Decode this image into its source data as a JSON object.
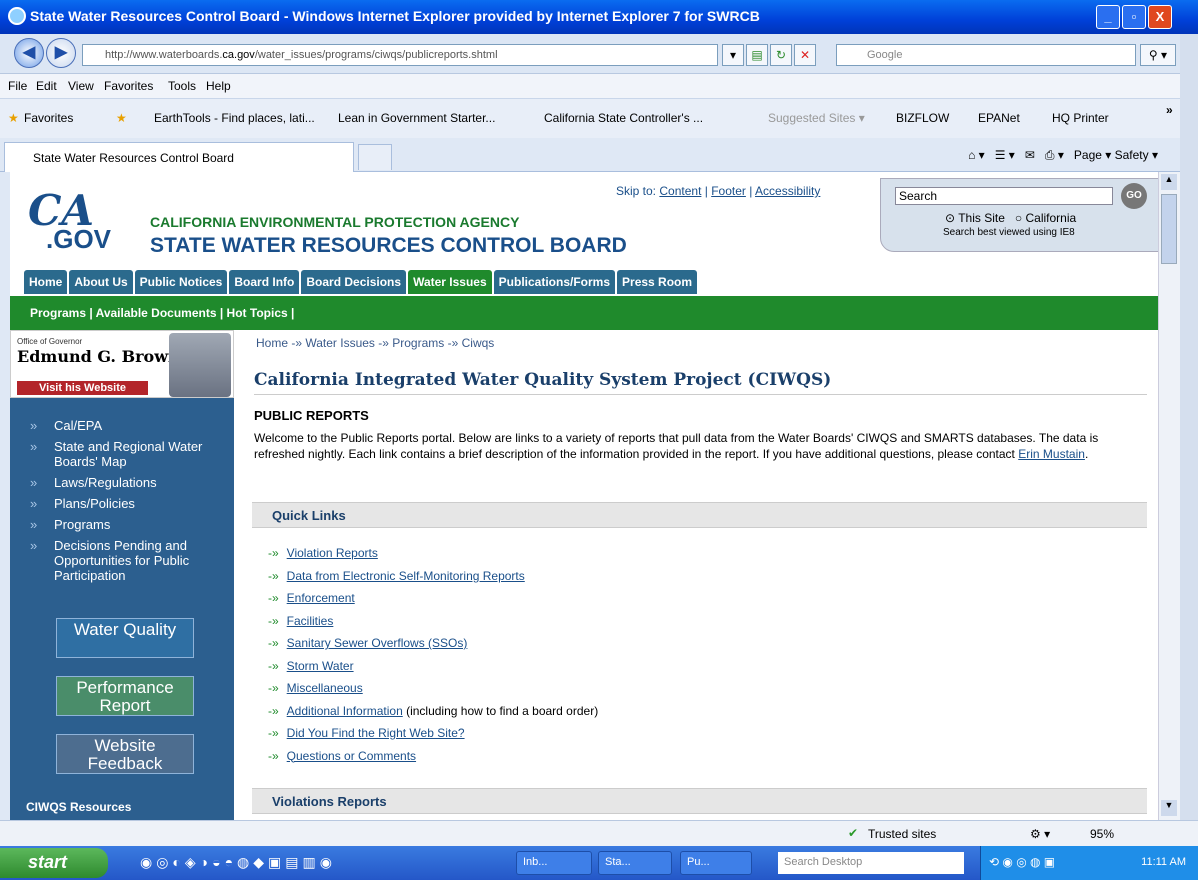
{
  "window": {
    "title": "State Water Resources Control Board - Windows Internet Explorer provided by Internet Explorer 7 for SWRCB",
    "minimize": "_",
    "maximize": "▫",
    "close": "X"
  },
  "address": {
    "url_prefix": "http://www.waterboards.",
    "url_domain": "ca.gov",
    "url_suffix": "/water_issues/programs/ciwqs/publicreports.shtml",
    "search_placeholder": "Google"
  },
  "menu": [
    "File",
    "Edit",
    "View",
    "Favorites",
    "Tools",
    "Help"
  ],
  "favorites": {
    "label": "Favorites",
    "items": [
      "EarthTools - Find places, lati...",
      "Lean in Government Starter...",
      "California State Controller's ...",
      "Suggested Sites ▾",
      "BIZFLOW",
      "EPANet",
      "HQ Printer"
    ]
  },
  "tab": {
    "title": "State Water Resources Control Board",
    "tools": "Page ▾  Safety ▾"
  },
  "site": {
    "logo_ca": "CA",
    "logo_gov": ".GOV",
    "agency": "CALIFORNIA ENVIRONMENTAL PROTECTION AGENCY",
    "board": "STATE WATER RESOURCES CONTROL BOARD",
    "skip_to": "Skip to:",
    "skip_content": "Content",
    "skip_footer": "Footer",
    "skip_access": "Accessibility",
    "search_value": "Search",
    "go": "GO",
    "radio_site": "This Site",
    "radio_ca": "California",
    "ie8_note": "Search best viewed using IE8"
  },
  "navtabs": [
    "Home",
    "About Us",
    "Public Notices",
    "Board Info",
    "Board Decisions",
    "Water Issues",
    "Publications/Forms",
    "Press Room"
  ],
  "subnav": "Programs | Available Documents | Hot Topics |",
  "sidebar": {
    "gov_office": "Office of Governor",
    "gov_name": "Edmund G. Brown Jr.",
    "gov_visit": "Visit his Website",
    "items": [
      "Cal/EPA",
      "State and Regional Water Boards' Map",
      "Laws/Regulations",
      "Plans/Policies",
      "Programs",
      "Decisions Pending and Opportunities for Public Participation"
    ],
    "wq": "Water Quality",
    "perf": "Performance Report",
    "feedback": "Website Feedback",
    "ciwqs": "CIWQS Resources"
  },
  "main": {
    "breadcrumb": "Home -» Water Issues -» Programs -» Ciwqs",
    "title": "California Integrated Water Quality System Project (CIWQS)",
    "subtitle": "PUBLIC REPORTS",
    "intro": "Welcome to the Public Reports portal. Below are links to a variety of reports that pull data from the Water Boards' CIWQS and SMARTS databases. The data is refreshed nightly. Each link contains a brief description of the information provided in the report. If you have additional questions, please contact ",
    "contact": "Erin Mustain",
    "period": ".",
    "quick_links_title": "Quick Links",
    "links": [
      "Violation Reports",
      "Data from Electronic Self-Monitoring Reports",
      "Enforcement",
      "Facilities",
      "Sanitary Sewer Overflows (SSOs)",
      "Storm Water",
      "Miscellaneous",
      "Additional Information",
      "Did You Find the Right Web Site?",
      "Questions or Comments"
    ],
    "additional_note": " (including how to find a board order)",
    "violations_title": "Violations Reports"
  },
  "status": {
    "zone": "Trusted sites",
    "zoom": "95%"
  },
  "taskbar": {
    "start": "start",
    "tasks": [
      "Inb...",
      "Sta...",
      "Pu..."
    ],
    "search": "Search Desktop",
    "clock": "11:11 AM"
  }
}
